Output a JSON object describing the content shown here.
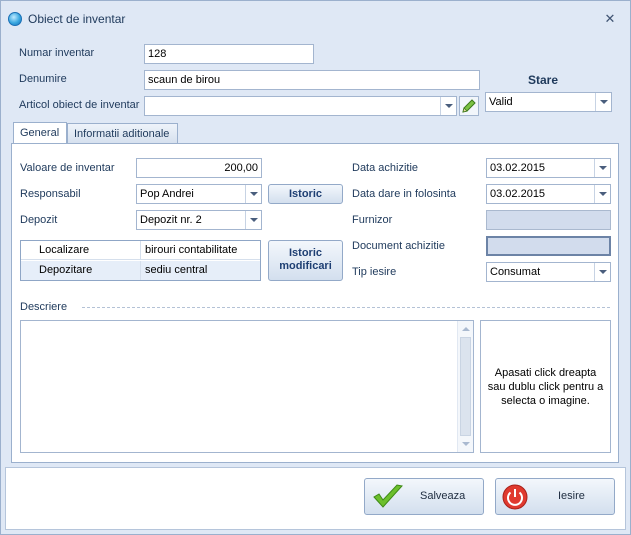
{
  "window": {
    "title": "Obiect de inventar"
  },
  "form": {
    "numar_label": "Numar inventar",
    "numar_value": "128",
    "denumire_label": "Denumire",
    "denumire_value": "scaun de birou",
    "articol_label": "Articol obiect de inventar",
    "articol_value": "",
    "stare_label": "Stare",
    "stare_value": "Valid"
  },
  "tabs": [
    {
      "label": "General",
      "active": true
    },
    {
      "label": "Informatii aditionale",
      "active": false
    }
  ],
  "general": {
    "valoare_label": "Valoare de inventar",
    "valoare_value": "200,00",
    "responsabil_label": "Responsabil",
    "responsabil_value": "Pop Andrei",
    "depozit_label": "Depozit",
    "depozit_value": "Depozit nr. 2",
    "istoric_label": "Istoric",
    "istoric_modificari_line1": "Istoric",
    "istoric_modificari_line2": "modificari",
    "location_grid": [
      {
        "key": "Localizare",
        "value": "birouri contabilitate"
      },
      {
        "key": "Depozitare",
        "value": "sediu central"
      }
    ],
    "data_achizitie_label": "Data achizitie",
    "data_achizitie_value": "03.02.2015",
    "data_dare_label": "Data dare in folosinta",
    "data_dare_value": "03.02.2015",
    "furnizor_label": "Furnizor",
    "furnizor_value": "",
    "document_label": "Document achizitie",
    "document_value": "",
    "tip_iesire_label": "Tip iesire",
    "tip_iesire_value": "Consumat",
    "descriere_label": "Descriere",
    "descriere_value": "",
    "image_hint": "Apasati click dreapta sau dublu click pentru a selecta o imagine."
  },
  "footer": {
    "save_label": "Salveaza",
    "exit_label": "Iesire"
  },
  "colors": {
    "accent": "#1e3f73",
    "window_bg": "#dfe8f5",
    "save_icon": "#6cbf2c",
    "exit_icon": "#e03a2f"
  }
}
